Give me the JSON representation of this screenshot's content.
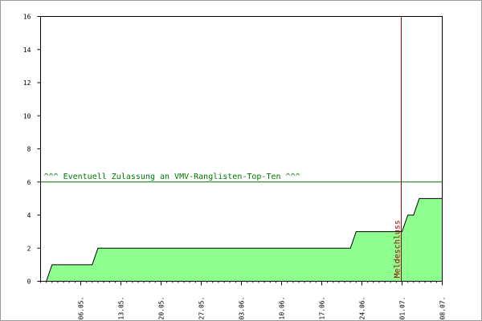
{
  "chart_data": {
    "type": "area",
    "title": "",
    "xlabel": "",
    "ylabel": "",
    "x_start": "29.04.",
    "x_end": "08.07.",
    "x_tick_labels": [
      "06.05.",
      "13.05.",
      "20.05.",
      "27.05.",
      "03.06.",
      "10.06.",
      "17.06.",
      "24.06.",
      "01.07.",
      "08.07."
    ],
    "ylim": [
      0,
      16
    ],
    "y_ticks": [
      0,
      2,
      4,
      6,
      8,
      10,
      12,
      14,
      16
    ],
    "series": [
      {
        "values": [
          {
            "x": "30.04.",
            "y": 0
          },
          {
            "x": "01.05.",
            "y": 1
          },
          {
            "x": "08.05.",
            "y": 1
          },
          {
            "x": "09.05.",
            "y": 2
          },
          {
            "x": "22.06.",
            "y": 2
          },
          {
            "x": "23.06.",
            "y": 3
          },
          {
            "x": "01.07.",
            "y": 3
          },
          {
            "x": "02.07.",
            "y": 4
          },
          {
            "x": "03.07.",
            "y": 4
          },
          {
            "x": "04.07.",
            "y": 5
          },
          {
            "x": "07.07.",
            "y": 5
          }
        ]
      }
    ],
    "annotations": {
      "threshold_value": 6,
      "threshold_label": "^^^ Eventuell Zulassung an VMV-Ranglisten-Top-Ten ^^^",
      "deadline_date": "01.07.",
      "deadline_label": "Meldeschluss"
    },
    "colors": {
      "fill": "#8eff8e",
      "line": "#000000",
      "threshold": "#007700",
      "deadline": "#990000"
    }
  }
}
